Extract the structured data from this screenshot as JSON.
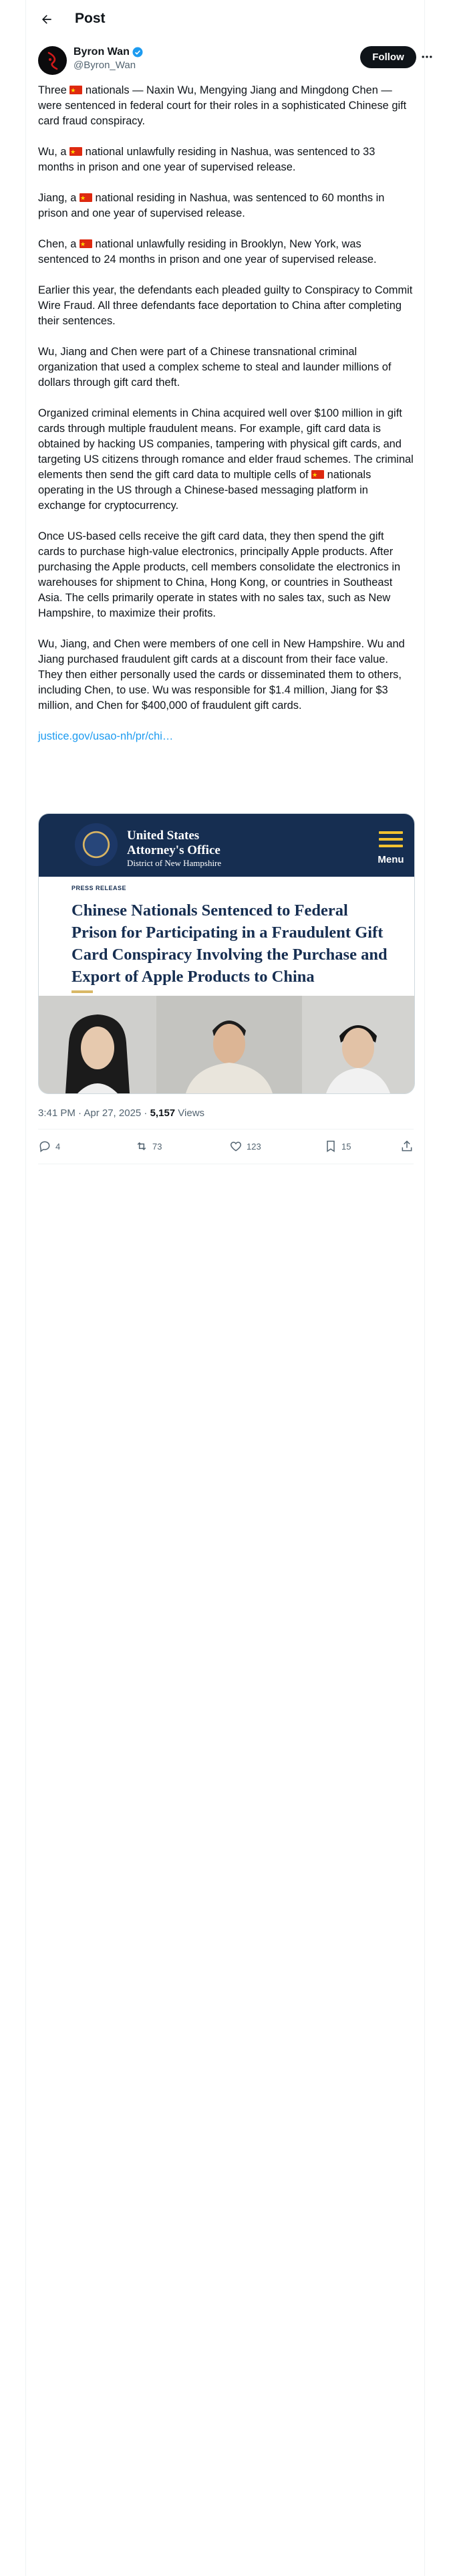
{
  "header": {
    "title": "Post"
  },
  "author": {
    "name": "Byron Wan",
    "handle": "@Byron_Wan",
    "verified": true
  },
  "follow_label": "Follow",
  "tweet": {
    "p1_pre": "Three ",
    "p1_post": " nationals — Naxin Wu, Mengying Jiang and Mingdong Chen — were sentenced in federal court for their roles in a sophisticated Chinese gift card fraud conspiracy.",
    "p2_pre": "Wu, a ",
    "p2_post": " national unlawfully residing in Nashua, was sentenced to 33 months in prison and one year of supervised release.",
    "p3_pre": "Jiang, a ",
    "p3_post": " national residing in Nashua, was sentenced to 60 months in prison and one year of supervised release.",
    "p4_pre": "Chen, a ",
    "p4_post": " national unlawfully residing in Brooklyn, New York, was sentenced to 24 months in prison and one year of supervised release.",
    "p5": "Earlier this year, the defendants each pleaded guilty to Conspiracy to Commit Wire Fraud.  All three defendants face deportation to China after completing their sentences.",
    "p6": "Wu, Jiang and Chen were part of a Chinese transnational criminal organization that used a complex scheme to steal and launder millions of dollars through gift card theft.",
    "p7": "Organized criminal elements in China acquired well over $100 million in gift cards through multiple fraudulent means. For example, gift card data is obtained by hacking US companies, tampering with physical gift cards, and targeting US citizens through romance and elder fraud schemes. The criminal elements then send the gift card data to multiple cells of ",
    "p7_post": " nationals operating in the US through a Chinese-based messaging platform in exchange for cryptocurrency.",
    "p8": "Once US-based cells receive the gift card data, they then spend the gift cards to purchase high-value electronics, principally Apple products. After purchasing the Apple products, cell members consolidate the electronics in warehouses for shipment to China, Hong Kong, or countries in Southeast Asia. The cells primarily operate in states with no sales tax, such as New Hampshire, to maximize their profits.",
    "p9": "Wu, Jiang, and Chen were members of one cell in New Hampshire. Wu and Jiang purchased fraudulent gift cards at a discount from their face value. They then either personally used the cards or disseminated them to others, including Chen, to use. Wu was responsible for $1.4 million, Jiang for $3 million, and Chen for $400,000 of fraudulent gift cards.",
    "link": "justice.gov/usao-nh/pr/chi…"
  },
  "card": {
    "office_line1": "United States",
    "office_line2": "Attorney's Office",
    "district": "District of New Hampshire",
    "menu_label": "Menu",
    "press_label": "PRESS RELEASE",
    "headline": "Chinese Nationals Sentenced to Federal Prison for Participating in a Fraudulent Gift Card Conspiracy Involving the Purchase and Export of Apple Products to China"
  },
  "meta": {
    "time": "3:41 PM · Apr 27, 2025 · ",
    "views_count": "5,157",
    "views_label": " Views"
  },
  "actions": {
    "replies": "4",
    "reposts": "73",
    "likes": "123",
    "bookmarks": "15"
  },
  "icons": [
    "back-arrow-icon",
    "verified-badge-icon",
    "more-icon",
    "flag-icon",
    "reply-icon",
    "repost-icon",
    "like-icon",
    "bookmark-icon",
    "share-icon"
  ],
  "colors": {
    "accent": "#1d9bf0",
    "card_navy": "#162e51",
    "flag_red": "#de2910"
  }
}
